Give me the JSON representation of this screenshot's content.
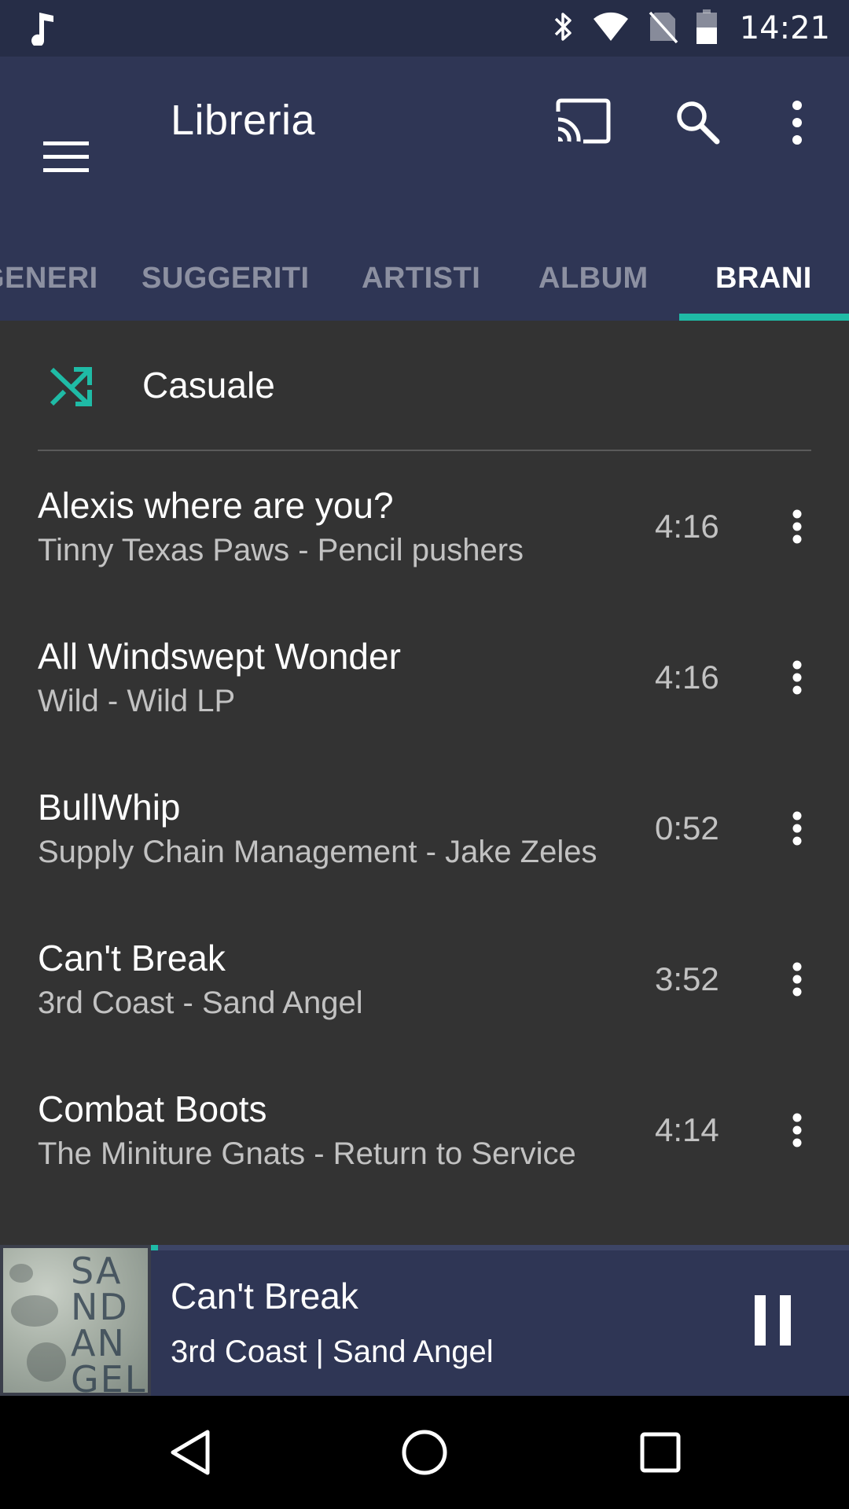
{
  "status_bar": {
    "time": "14:21",
    "icons": [
      "music-note-icon",
      "bluetooth-icon",
      "wifi-icon",
      "no-sim-icon",
      "battery-icon"
    ]
  },
  "app_bar": {
    "title": "Libreria",
    "icons": [
      "menu-icon",
      "cast-icon",
      "search-icon",
      "more-vert-icon"
    ]
  },
  "tabs": [
    {
      "label": "GENERI",
      "active": false
    },
    {
      "label": "SUGGERITI",
      "active": false
    },
    {
      "label": "ARTISTI",
      "active": false
    },
    {
      "label": "ALBUM",
      "active": false
    },
    {
      "label": "BRANI",
      "active": true
    }
  ],
  "shuffle": {
    "label": "Casuale",
    "icon": "shuffle-icon"
  },
  "songs": [
    {
      "title": "Alexis where are you?",
      "subtitle": "Tinny Texas Paws - Pencil pushers",
      "duration": "4:16"
    },
    {
      "title": "All Windswept Wonder",
      "subtitle": "Wild - Wild LP",
      "duration": "4:16"
    },
    {
      "title": "BullWhip",
      "subtitle": "Supply Chain Management - Jake Zeles",
      "duration": "0:52"
    },
    {
      "title": "Can't Break",
      "subtitle": "3rd Coast - Sand Angel",
      "duration": "3:52"
    },
    {
      "title": "Combat Boots",
      "subtitle": "The Miniture Gnats - Return to Service",
      "duration": "4:14"
    }
  ],
  "now_playing": {
    "title": "Can't Break",
    "subtitle": "3rd Coast | Sand Angel",
    "album_art_text": "SAND ANGEL",
    "progress_fraction": 0.01
  },
  "colors": {
    "accent": "#1fbba6",
    "primary": "#2f3655",
    "status_bar": "#262d47",
    "background": "#333333"
  }
}
